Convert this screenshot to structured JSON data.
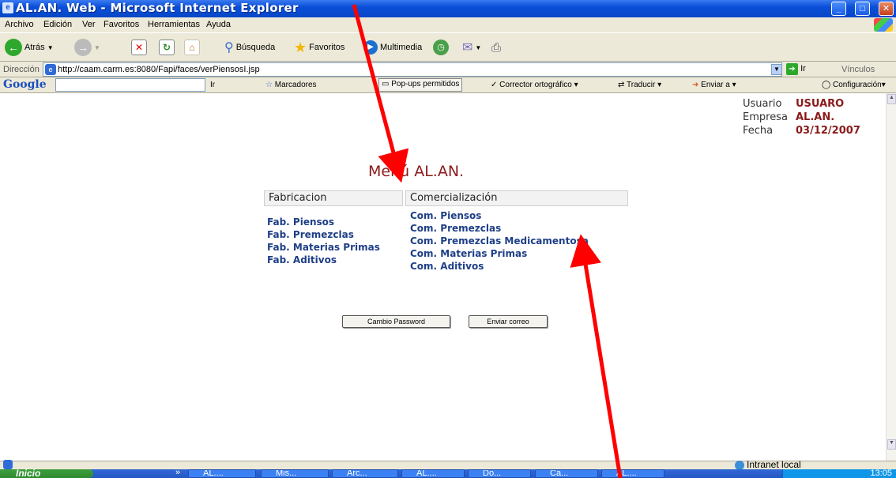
{
  "window": {
    "title": "AL.AN. Web - Microsoft Internet Explorer",
    "min_glyph": "_",
    "max_glyph": "□",
    "close_glyph": "✕"
  },
  "menubar": {
    "items": [
      "Archivo",
      "Edición",
      "Ver",
      "Favoritos",
      "Herramientas",
      "Ayuda"
    ]
  },
  "toolbar": {
    "back_label": "Atrás",
    "search_label": "Búsqueda",
    "favorites_label": "Favoritos",
    "multimedia_label": "Multimedia"
  },
  "addressbar": {
    "label": "Dirección",
    "url": "http://caam.carm.es:8080/Fapi/faces/verPiensosI.jsp",
    "go_label": "Ir",
    "links_label": "Vínculos"
  },
  "googlebar": {
    "logo": "Google",
    "go_label": "Ir",
    "bookmarks_label": "Marcadores",
    "popups_label": "Pop-ups permitidos",
    "spell_label": "Corrector ortográfico",
    "translate_label": "Traducir",
    "send_label": "Enviar a",
    "config_label": "Configuración"
  },
  "user_info": {
    "usuario_label": "Usuario",
    "usuario_value": "USUARO",
    "empresa_label": "Empresa",
    "empresa_value": "AL.AN.",
    "fecha_label": "Fecha",
    "fecha_value": "03/12/2007"
  },
  "page": {
    "menu_title": "Menú AL.AN.",
    "fabricacion_header": "Fabricacion",
    "comercializacion_header": "Comercialización",
    "fabricacion_links": [
      "Fab. Piensos",
      "Fab. Premezclas",
      "Fab. Materias Primas",
      "Fab. Aditivos"
    ],
    "comercializacion_links": [
      "Com. Piensos",
      "Com. Premezclas",
      "Com. Premezclas Medicamentosa",
      "Com. Materias Primas",
      "Com. Aditivos"
    ],
    "cambio_password_label": "Cambio Password",
    "enviar_correo_label": "Enviar correo"
  },
  "statusbar": {
    "zone_label": "Intranet local"
  },
  "taskbar": {
    "start_label": "Inicio",
    "more_glyph": "»",
    "tasks": [
      "AL....",
      "Mis...",
      "Arc...",
      "AL....",
      "Do...",
      "Ca...",
      "AL...."
    ],
    "clock": "13:05"
  },
  "colors": {
    "accent_red": "#8b1a1a",
    "link_blue": "#1e3f87",
    "annotation_arrow": "#ff0000"
  }
}
